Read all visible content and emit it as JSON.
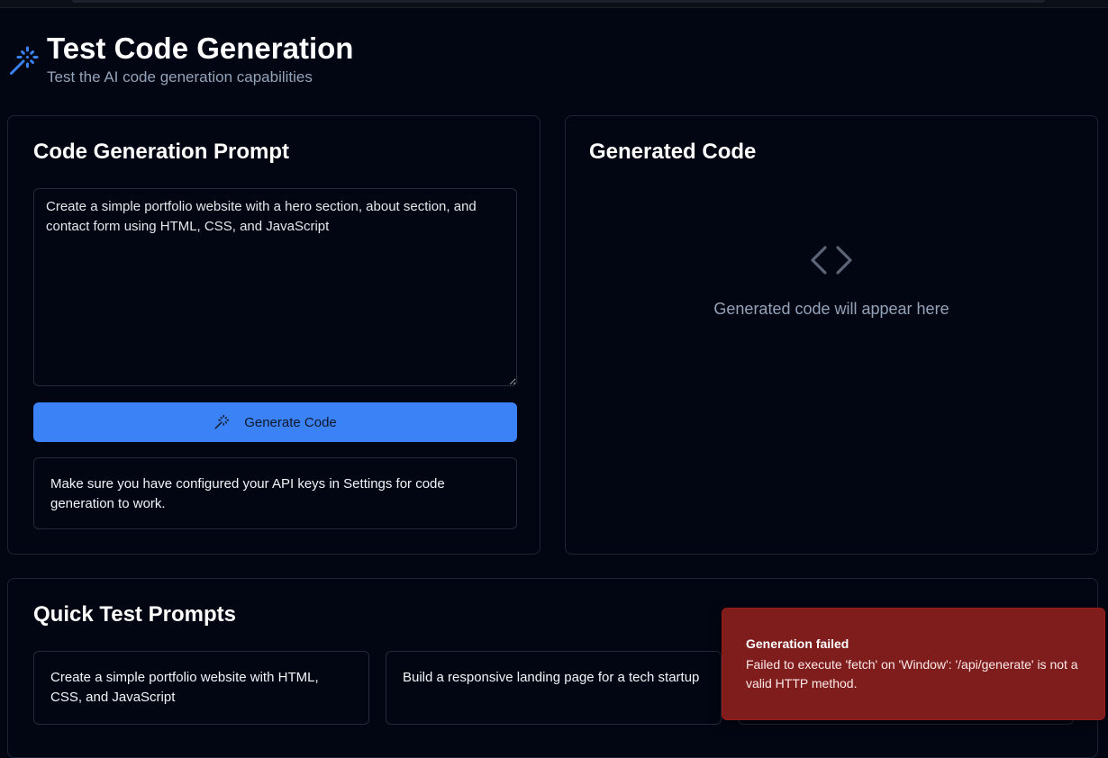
{
  "header": {
    "title": "Test Code Generation",
    "subtitle": "Test the AI code generation capabilities",
    "icon": "magic-wand-icon"
  },
  "prompt_panel": {
    "title": "Code Generation Prompt",
    "prompt_value": "Create a simple portfolio website with a hero section, about section, and contact form using HTML, CSS, and JavaScript",
    "generate_label": "Generate Code",
    "generate_icon": "magic-wand-icon",
    "info_text": "Make sure you have configured your API keys in Settings for code generation to work."
  },
  "output_panel": {
    "title": "Generated Code",
    "icon": "code-icon",
    "placeholder": "Generated code will appear here"
  },
  "quick_prompts": {
    "title": "Quick Test Prompts",
    "items": [
      {
        "label": "Create a simple portfolio website with HTML, CSS, and JavaScript"
      },
      {
        "label": "Build a responsive landing page for a tech startup"
      },
      {
        "label": ""
      }
    ]
  },
  "toast": {
    "title": "Generation failed",
    "message": "Failed to execute 'fetch' on 'Window': '/api/generate' is not a valid HTTP method."
  },
  "colors": {
    "background": "#020612",
    "accent": "#3b82f6",
    "error": "#7f1d1d",
    "muted_text": "#94a3b8"
  }
}
